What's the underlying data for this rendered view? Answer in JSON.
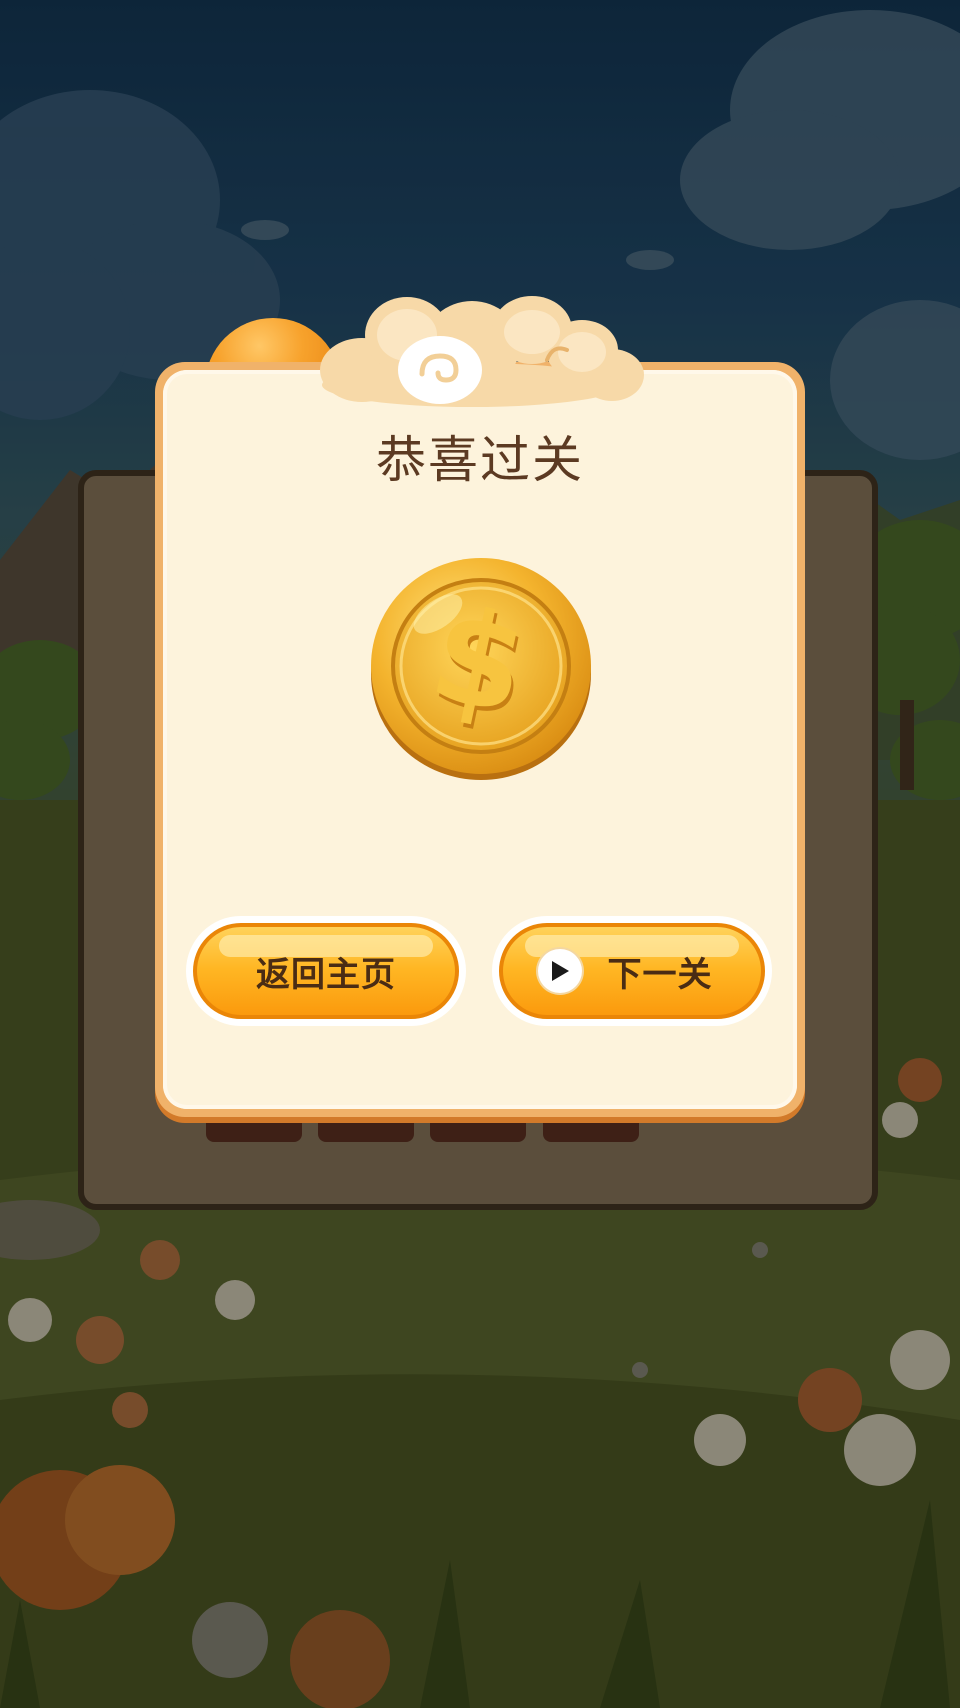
{
  "dialog": {
    "title": "恭喜过关"
  },
  "buttons": {
    "home_label": "返回主页",
    "next_label": "下一关"
  },
  "icons": {
    "reward": "dollar-coin-icon",
    "next": "play-icon"
  },
  "colors": {
    "dialog_border": "#f0b26a",
    "dialog_fill": "#fdf3dc",
    "button_fill": "#ffb623",
    "title_text": "#5c3a22",
    "coin_gold": "#f2b533"
  }
}
